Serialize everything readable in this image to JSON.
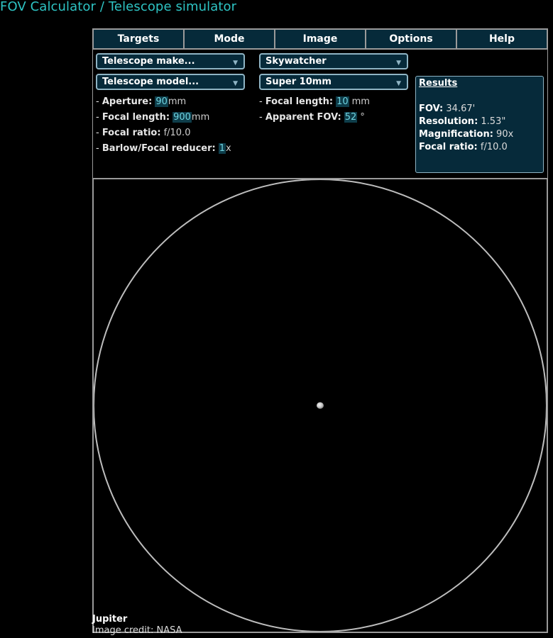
{
  "page": {
    "title": "FOV Calculator / Telescope simulator"
  },
  "menu": [
    {
      "key": "targets",
      "label": "Targets"
    },
    {
      "key": "mode",
      "label": "Mode"
    },
    {
      "key": "image",
      "label": "Image"
    },
    {
      "key": "options",
      "label": "Options"
    },
    {
      "key": "help",
      "label": "Help"
    }
  ],
  "telescope": {
    "make_dropdown": "Telescope make...",
    "model_dropdown": "Telescope model...",
    "aperture_label": "Aperture:",
    "aperture_value": "90",
    "aperture_unit": "mm",
    "focal_length_label": "Focal length:",
    "focal_length_value": "900",
    "focal_length_unit": "mm",
    "focal_ratio_label": "Focal ratio:",
    "focal_ratio_value": "f/10.0",
    "barlow_label": "Barlow/Focal reducer:",
    "barlow_value": "1",
    "barlow_unit": "x"
  },
  "eyepiece": {
    "make_dropdown": "Skywatcher",
    "model_dropdown": "Super 10mm",
    "focal_length_label": "Focal length:",
    "focal_length_value": "10",
    "focal_length_unit": "mm",
    "apparent_fov_label": "Apparent FOV:",
    "apparent_fov_value": "52",
    "apparent_fov_unit": "°"
  },
  "results": {
    "title": "Results",
    "fov_label": "FOV:",
    "fov_value": "34.67'",
    "resolution_label": "Resolution:",
    "resolution_value": "1.53\"",
    "magnification_label": "Magnification:",
    "magnification_value": "90x",
    "focal_ratio_label": "Focal ratio:",
    "focal_ratio_value": "f/10.0"
  },
  "caption": {
    "target": "Jupiter",
    "credit": "Image credit: NASA"
  },
  "icons": {
    "dropdown_caret": "chevron-down-icon"
  },
  "colors": {
    "title": "#2ec4c4",
    "panel_bg": "#062a3a",
    "input_bg": "#0e3d4a",
    "input_text": "#6fd3e0",
    "border": "#9a9a9a",
    "fov_circle": "#bdbdbd"
  }
}
